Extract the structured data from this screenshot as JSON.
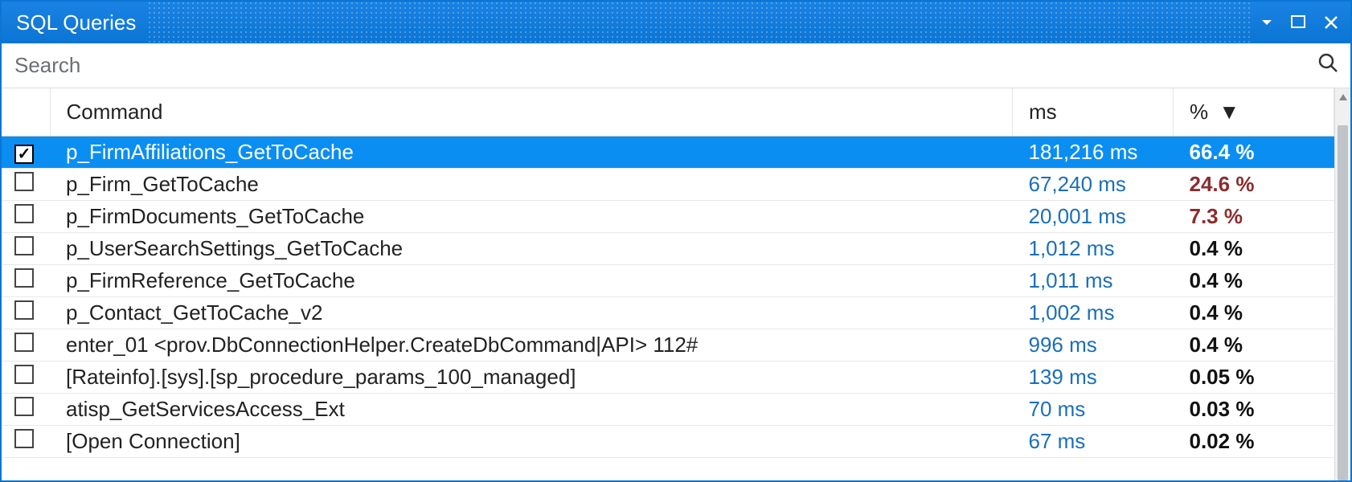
{
  "window": {
    "title": "SQL Queries"
  },
  "search": {
    "placeholder": "Search"
  },
  "columns": {
    "command": "Command",
    "ms": "ms",
    "percent": "%"
  },
  "sort": {
    "column": "percent",
    "direction": "desc",
    "indicator": "▼"
  },
  "rows": [
    {
      "checked": true,
      "command": "p_FirmAffiliations_GetToCache",
      "ms": "181,216 ms",
      "percent": "66.4 %",
      "selected": true,
      "pct_class": "top"
    },
    {
      "checked": false,
      "command": "p_Firm_GetToCache",
      "ms": "67,240 ms",
      "percent": "24.6 %",
      "pct_class": "high"
    },
    {
      "checked": false,
      "command": "p_FirmDocuments_GetToCache",
      "ms": "20,001 ms",
      "percent": "7.3 %",
      "pct_class": "high"
    },
    {
      "checked": false,
      "command": "p_UserSearchSettings_GetToCache",
      "ms": "1,012 ms",
      "percent": "0.4 %"
    },
    {
      "checked": false,
      "command": "p_FirmReference_GetToCache",
      "ms": "1,011 ms",
      "percent": "0.4 %"
    },
    {
      "checked": false,
      "command": "p_Contact_GetToCache_v2",
      "ms": "1,002 ms",
      "percent": "0.4 %"
    },
    {
      "checked": false,
      "command": "enter_01 <prov.DbConnectionHelper.CreateDbCommand|API> 112#",
      "ms": "996 ms",
      "percent": "0.4 %"
    },
    {
      "checked": false,
      "command": "[Rateinfo].[sys].[sp_procedure_params_100_managed]",
      "ms": "139 ms",
      "percent": "0.05 %"
    },
    {
      "checked": false,
      "command": "atisp_GetServicesAccess_Ext",
      "ms": "70 ms",
      "percent": "0.03 %"
    },
    {
      "checked": false,
      "command": "[Open Connection]",
      "ms": "67 ms",
      "percent": "0.02 %"
    }
  ]
}
